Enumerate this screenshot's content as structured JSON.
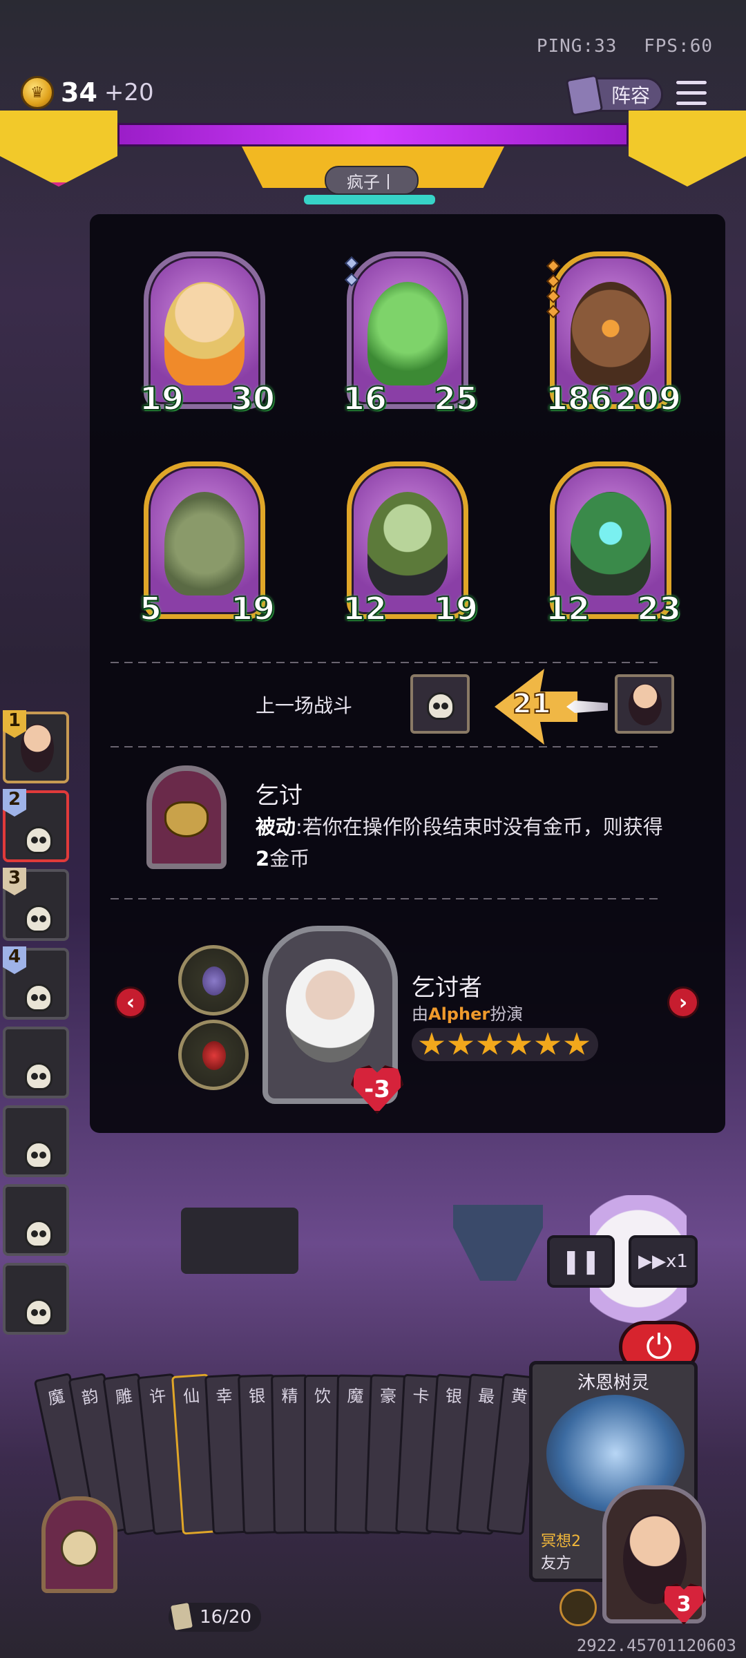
{
  "hud": {
    "ping": "PING:33",
    "fps": "FPS:60",
    "gold": "34",
    "gold_income": "+20",
    "lineup_label": "阵容"
  },
  "opponent_name": "疯子丨",
  "board": [
    {
      "atk": "19",
      "hp": "30"
    },
    {
      "atk": "16",
      "hp": "25"
    },
    {
      "atk": "186",
      "hp": "209"
    },
    {
      "atk": "5",
      "hp": "19"
    },
    {
      "atk": "12",
      "hp": "19"
    },
    {
      "atk": "12",
      "hp": "23"
    }
  ],
  "last_battle": {
    "label": "上一场战斗",
    "damage": "21"
  },
  "trait": {
    "name": "乞讨",
    "passive_label": "被动",
    "description": ":若你在操作阶段结束时没有金币，则获得",
    "amount": "2",
    "description_end": "金币"
  },
  "hero": {
    "name": "乞讨者",
    "by_prefix": "由",
    "voice": "Alpher",
    "by_suffix": "扮演",
    "health": "-3",
    "stars": 6
  },
  "roster": [
    {
      "rank": "1"
    },
    {
      "rank": "2"
    },
    {
      "rank": "3"
    },
    {
      "rank": "4"
    },
    {
      "rank": ""
    },
    {
      "rank": ""
    },
    {
      "rank": ""
    },
    {
      "rank": ""
    }
  ],
  "controls": {
    "speed": "▶▶x1"
  },
  "hand": {
    "cards": [
      "魔",
      "韵",
      "雕",
      "许",
      "仙",
      "幸",
      "银",
      "精",
      "饮",
      "魔",
      "豪",
      "卡",
      "银",
      "最",
      "黄"
    ],
    "featured_name": "沐恩树灵",
    "featured_tag": "冥想2",
    "featured_tag2": "友方",
    "deck_count": "16/20"
  },
  "player": {
    "health": "3"
  },
  "coords": "2922.45701120603",
  "colors": {
    "accent_purple": "#d23cff",
    "gold": "#f2b822",
    "danger": "#d7242e",
    "stat_green": "#58e06c"
  }
}
